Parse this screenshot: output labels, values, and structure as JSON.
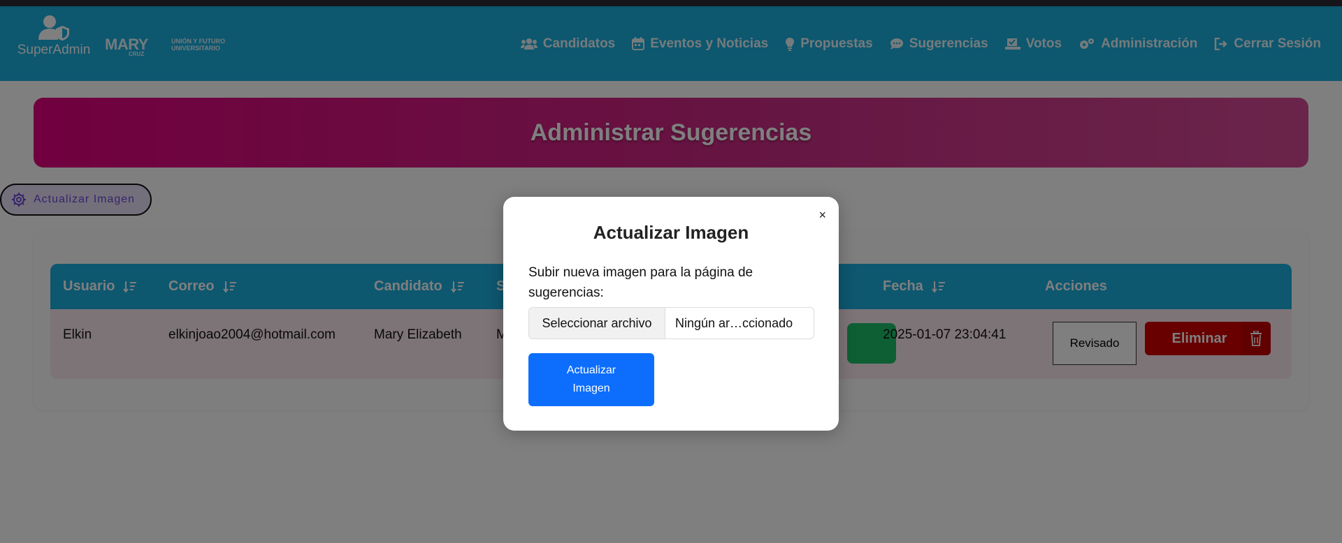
{
  "header": {
    "user_role": "SuperAdmin",
    "brand_main": "MARY",
    "brand_sub": "CRUZ",
    "brand_tagline": "UNIÓN Y FUTURO UNIVERSITARIO",
    "nav": [
      {
        "label": "Candidatos",
        "icon": "users-icon"
      },
      {
        "label": "Eventos y Noticias",
        "icon": "calendar-icon"
      },
      {
        "label": "Propuestas",
        "icon": "lightbulb-icon"
      },
      {
        "label": "Sugerencias",
        "icon": "comments-icon"
      },
      {
        "label": "Votos",
        "icon": "vote-icon"
      },
      {
        "label": "Administración",
        "icon": "gears-icon"
      },
      {
        "label": "Cerrar Sesión",
        "icon": "logout-icon"
      }
    ]
  },
  "page": {
    "title": "Administrar Sugerencias",
    "update_image_button": "Actualizar Imagen"
  },
  "table": {
    "headers": [
      "Usuario",
      "Correo",
      "Candidato",
      "S",
      "Fecha",
      "Acciones"
    ],
    "rows": [
      {
        "usuario": "Elkin",
        "correo": "elkinjoao2004@hotmail.com",
        "candidato": "Mary Elizabeth",
        "sugerencia_partial": "M",
        "fecha": "2025-01-07 23:04:41",
        "reviewed_label": "Revisado",
        "delete_label": "Eliminar"
      }
    ]
  },
  "modal": {
    "title": "Actualizar Imagen",
    "close": "×",
    "description": "Subir nueva imagen para la página de sugerencias:",
    "file_button": "Seleccionar archivo",
    "file_name": "Ningún ar…ccionado",
    "submit": "Actualizar Imagen"
  },
  "colors": {
    "header_bg": "#1aaede",
    "banner_start": "#e2007f",
    "delete_red": "#d00000",
    "primary_blue": "#0d6efd"
  }
}
